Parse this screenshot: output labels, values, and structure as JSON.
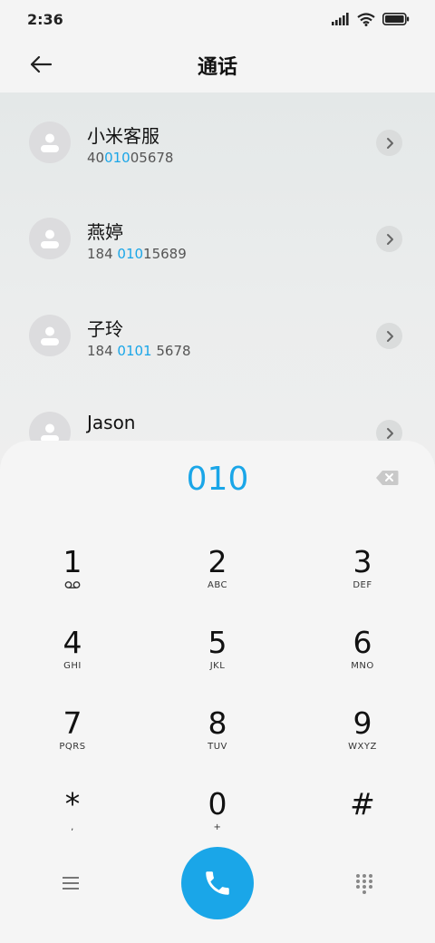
{
  "status_bar": {
    "time": "2:36"
  },
  "header": {
    "title": "通话"
  },
  "contacts": [
    {
      "name": "小米客服",
      "number_parts": [
        "40",
        "010",
        "05678"
      ]
    },
    {
      "name": "燕婷",
      "number_parts": [
        "184 ",
        "010",
        "15689"
      ]
    },
    {
      "name": "子玲",
      "number_parts": [
        "184 ",
        "0101",
        " 5678"
      ]
    },
    {
      "name": "Jason",
      "number_parts": [
        "",
        "",
        ""
      ]
    }
  ],
  "dialpad": {
    "input": "010",
    "keys": [
      {
        "digit": "1",
        "letters": ""
      },
      {
        "digit": "2",
        "letters": "ABC"
      },
      {
        "digit": "3",
        "letters": "DEF"
      },
      {
        "digit": "4",
        "letters": "GHI"
      },
      {
        "digit": "5",
        "letters": "JKL"
      },
      {
        "digit": "6",
        "letters": "MNO"
      },
      {
        "digit": "7",
        "letters": "PQRS"
      },
      {
        "digit": "8",
        "letters": "TUV"
      },
      {
        "digit": "9",
        "letters": "WXYZ"
      },
      {
        "digit": "*",
        "letters": ","
      },
      {
        "digit": "0",
        "letters": "+"
      },
      {
        "digit": "#",
        "letters": ""
      }
    ]
  },
  "colors": {
    "accent": "#1aa6e8",
    "background": "#f4f4f4"
  },
  "icons": {
    "back": "arrow-left-icon",
    "chevron": "chevron-right-icon",
    "backspace": "backspace-icon",
    "voicemail": "voicemail-icon",
    "call": "phone-icon",
    "menu": "menu-icon",
    "keypad": "keypad-icon"
  }
}
